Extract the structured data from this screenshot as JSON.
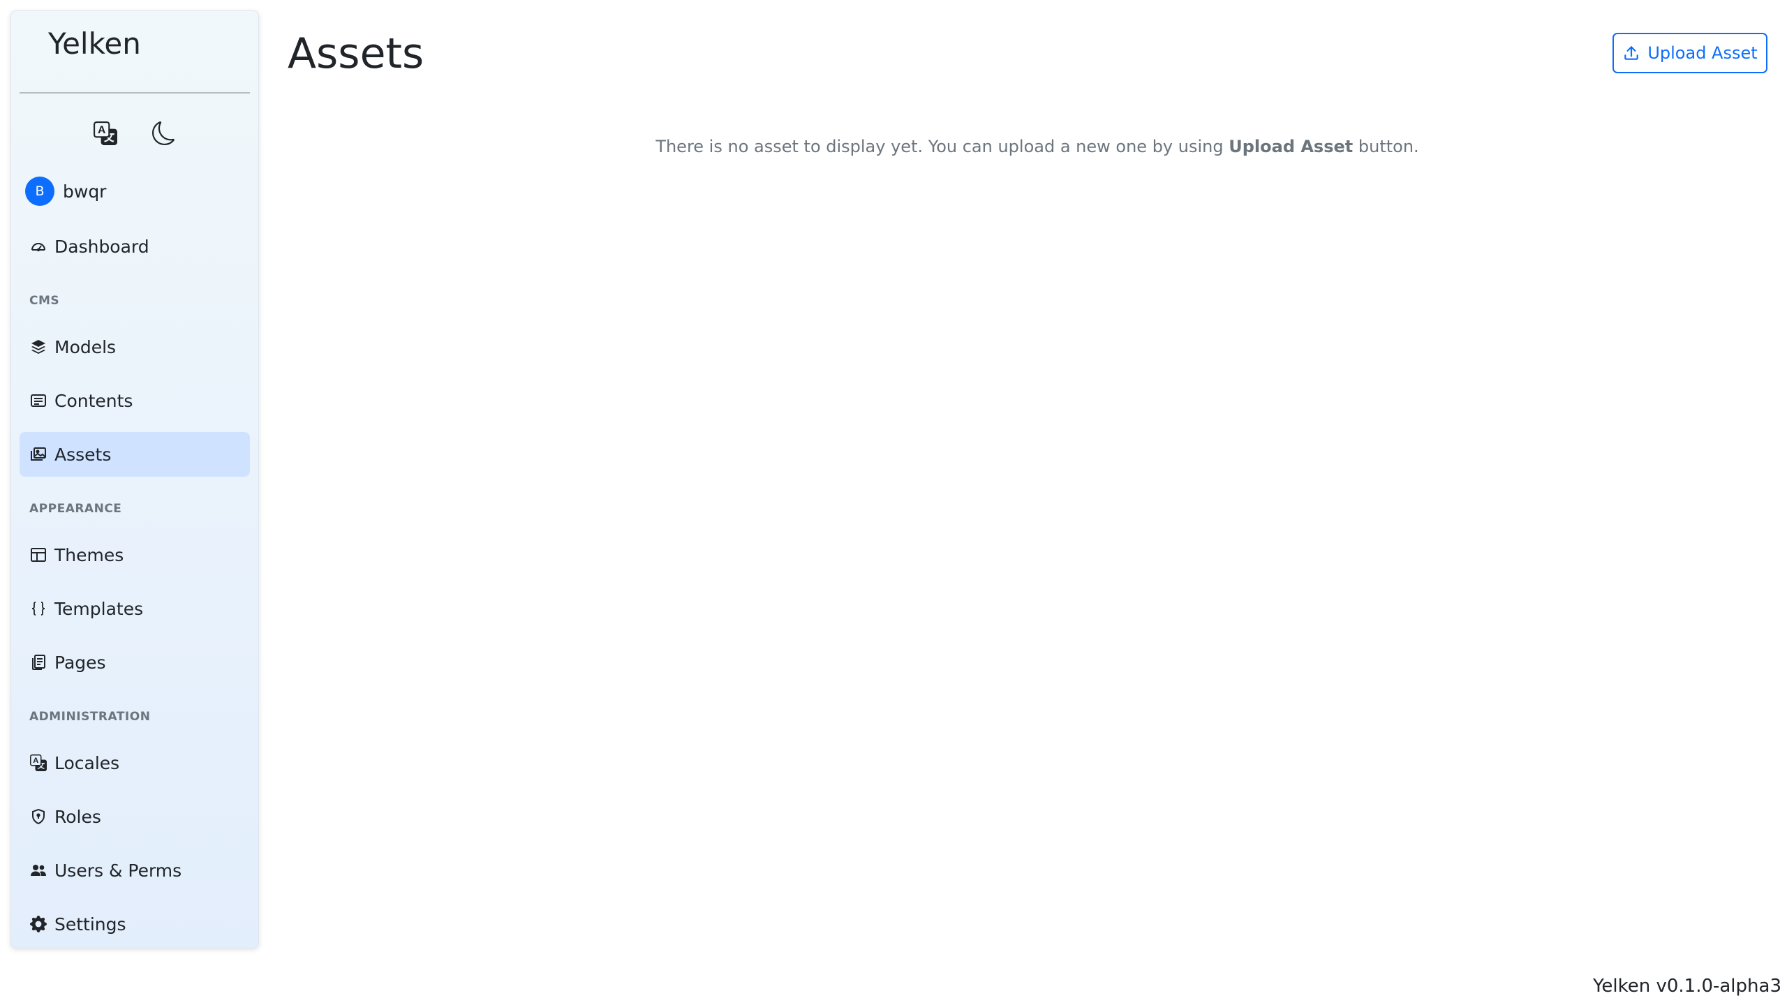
{
  "sidebar": {
    "brand": "Yelken",
    "utility": {
      "language_icon": "translate-icon",
      "theme_icon": "moon-icon"
    },
    "user": {
      "initial": "B",
      "name": "bwqr"
    },
    "dashboard": {
      "label": "Dashboard",
      "icon": "speedometer-icon"
    },
    "sections": [
      {
        "heading": "CMS",
        "items": [
          {
            "label": "Models",
            "icon": "stack-icon"
          },
          {
            "label": "Contents",
            "icon": "card-text-icon"
          },
          {
            "label": "Assets",
            "icon": "images-icon",
            "active": true
          }
        ]
      },
      {
        "heading": "APPEARANCE",
        "items": [
          {
            "label": "Themes",
            "icon": "layout-icon"
          },
          {
            "label": "Templates",
            "icon": "braces-icon"
          },
          {
            "label": "Pages",
            "icon": "files-icon"
          }
        ]
      },
      {
        "heading": "ADMINISTRATION",
        "items": [
          {
            "label": "Locales",
            "icon": "translate-icon"
          },
          {
            "label": "Roles",
            "icon": "shield-icon"
          },
          {
            "label": "Users & Perms",
            "icon": "people-icon"
          },
          {
            "label": "Settings",
            "icon": "gear-icon"
          }
        ]
      }
    ]
  },
  "main": {
    "title": "Assets",
    "upload_button": {
      "label": "Upload Asset",
      "icon": "upload-icon"
    },
    "empty_message": {
      "before": "There is no asset to display yet. You can upload a new one by using ",
      "emphasis": "Upload Asset",
      "after": " button."
    }
  },
  "footer": {
    "version": "Yelken v0.1.0-alpha3"
  },
  "colors": {
    "accent": "#0d6efd",
    "active_bg": "#cfe2ff",
    "muted_text": "#6c757d",
    "text": "#212529"
  }
}
